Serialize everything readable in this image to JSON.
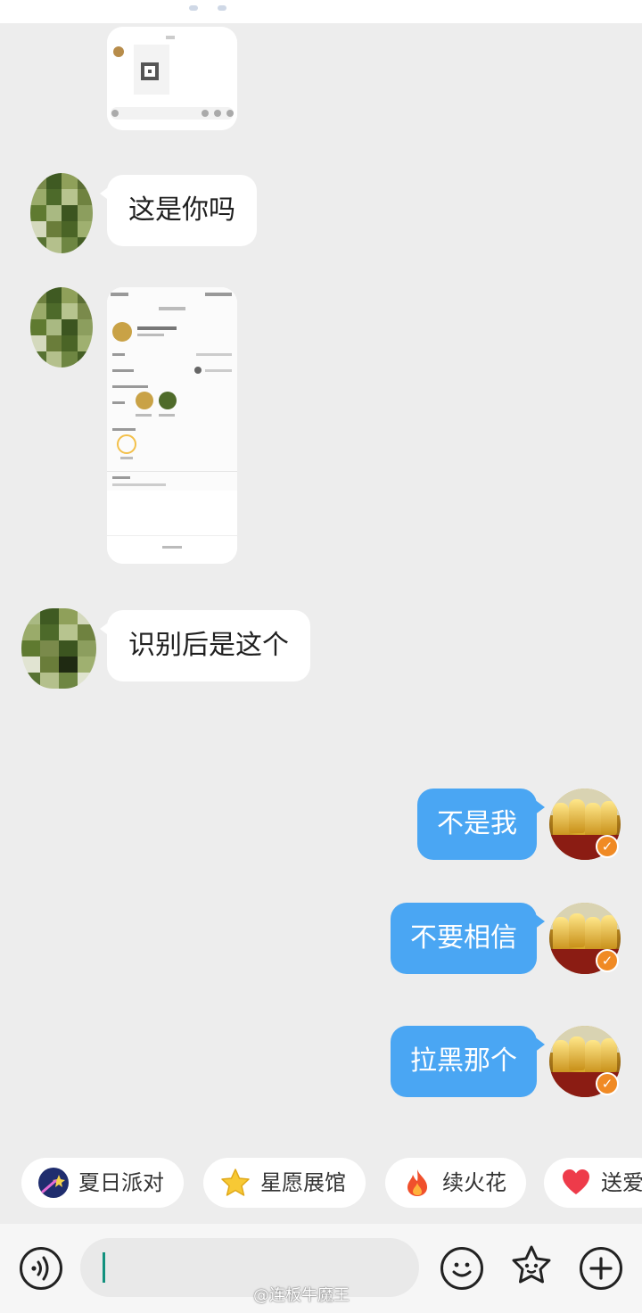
{
  "messages_in": [
    {
      "text": "这是你吗"
    },
    {
      "text": "识别后是这个"
    }
  ],
  "messages_out": [
    {
      "text": "不是我"
    },
    {
      "text": "不要相信"
    },
    {
      "text": "拉黑那个"
    }
  ],
  "quick_chips": [
    {
      "label": "夏日派对",
      "icon": "shooting-star-icon"
    },
    {
      "label": "星愿展馆",
      "icon": "star-icon"
    },
    {
      "label": "续火花",
      "icon": "fire-icon"
    },
    {
      "label": "送爱",
      "icon": "heart-icon"
    }
  ],
  "input_bar": {
    "icons": [
      "voice-icon",
      "emoji-icon",
      "sticker-icon",
      "plus-icon"
    ],
    "placeholder": ""
  },
  "watermark": "@连板牛魔王",
  "colors": {
    "background": "#ededed",
    "outgoing_bubble": "#4aa6f3",
    "incoming_bubble": "#ffffff",
    "badge": "#f08a24"
  }
}
